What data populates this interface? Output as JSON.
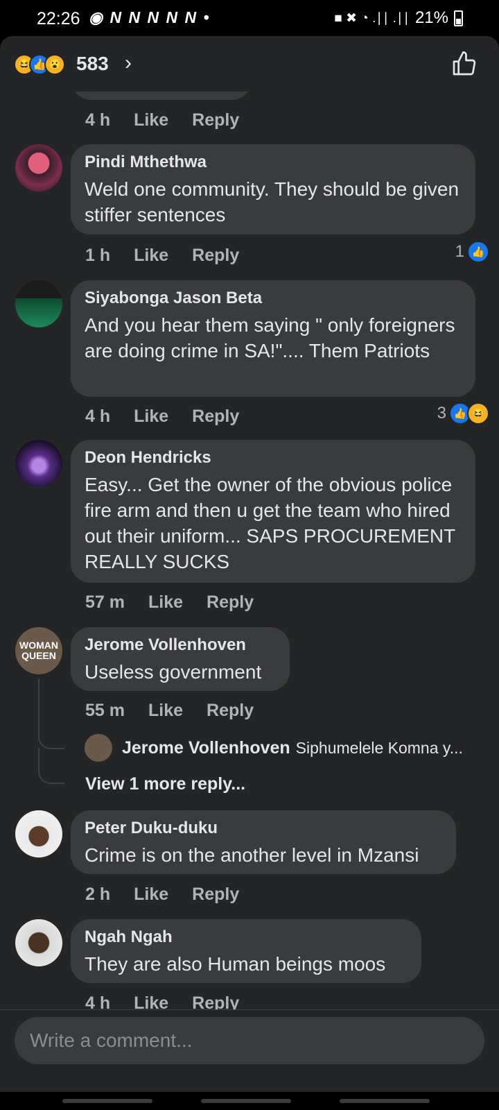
{
  "status_bar": {
    "time": "22:26",
    "notifications": "◉ N N N N N •",
    "signal": "■ ✖ ◔ .∣∣ .∣∣",
    "battery": "21%"
  },
  "header": {
    "reaction_icons": [
      "haha-icon",
      "like-icon",
      "wow-icon"
    ],
    "reaction_count": "583",
    "chevron": "›"
  },
  "comments": [
    {
      "id": "c0",
      "time": "4 h",
      "like": "Like",
      "reply": "Reply"
    },
    {
      "id": "c1",
      "name": "Pindi Mthethwa",
      "text": "Weld one community. They should be given stiffer sentences",
      "time": "1 h",
      "like": "Like",
      "reply": "Reply",
      "reactions": {
        "count": "1",
        "icons": [
          "like-icon"
        ]
      }
    },
    {
      "id": "c2",
      "name": "Siyabonga Jason Beta",
      "text": "And you hear them saying \" only foreigners are doing crime in SA!\".... Them Patriots",
      "time": "4 h",
      "like": "Like",
      "reply": "Reply",
      "reactions": {
        "count": "3",
        "icons": [
          "like-icon",
          "haha-icon"
        ]
      }
    },
    {
      "id": "c3",
      "name": "Deon Hendricks",
      "text": "Easy... Get the owner of the obvious police fire arm and then u get the team who hired out their uniform... SAPS PROCUREMENT REALLY SUCKS",
      "time": "57 m",
      "like": "Like",
      "reply": "Reply"
    },
    {
      "id": "c4",
      "name": "Jerome Vollenhoven",
      "text": "Useless government",
      "time": "55 m",
      "like": "Like",
      "reply": "Reply",
      "avatar_text": [
        "WOMAN",
        "QUEEN"
      ],
      "reply_preview": {
        "name": "Jerome Vollenhoven",
        "text": "Siphumelele Komna y..."
      },
      "view_more": "View 1 more reply..."
    },
    {
      "id": "c5",
      "name": "Peter Duku-duku",
      "text": "Crime is on the another level in Mzansi",
      "time": "2 h",
      "like": "Like",
      "reply": "Reply"
    },
    {
      "id": "c6",
      "name": "Ngah Ngah",
      "text": "They are also Human beings moos",
      "time": "4 h",
      "like": "Like",
      "reply": "Reply"
    }
  ],
  "composer": {
    "placeholder": "Write a comment..."
  },
  "colors": {
    "background": "#242526",
    "bubble": "#3a3b3c",
    "accent_like": "#1877f2",
    "haha": "#f7b125",
    "secondary_text": "#b0b3b8"
  }
}
